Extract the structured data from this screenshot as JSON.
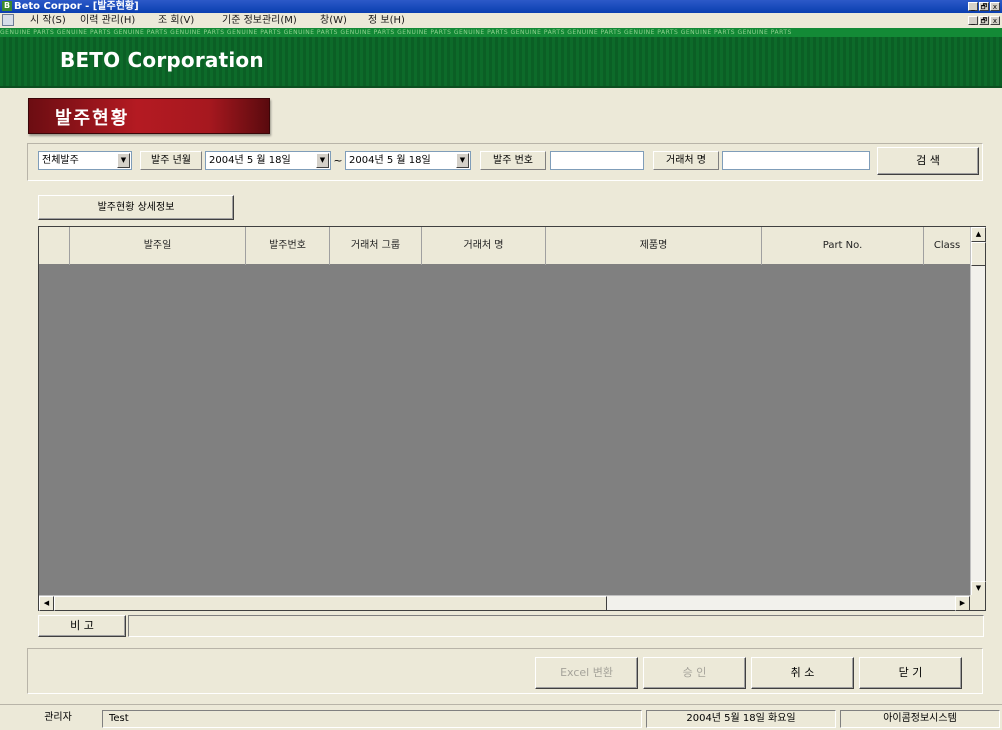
{
  "window": {
    "title": "Beto Corpor - [발주현황]",
    "controls": [
      "_",
      "🗗",
      "x"
    ]
  },
  "menu": {
    "items": [
      "시 작(S)",
      "이력 관리(H)",
      "조 회(V)",
      "기준 정보관리(M)",
      "창(W)",
      "정 보(H)"
    ]
  },
  "banner": {
    "company": "BETO Corporation",
    "pattern_text": "GENUINE PARTS GENUINE PARTS GENUINE PARTS GENUINE PARTS GENUINE PARTS GENUINE PARTS GENUINE PARTS GENUINE PARTS GENUINE PARTS GENUINE PARTS GENUINE PARTS GENUINE PARTS GENUINE PARTS GENUINE PARTS"
  },
  "screen_title": "발주현황",
  "search": {
    "order_type": "전체발주",
    "order_date_label": "발주 년월",
    "date_from": "2004년 5 월 18일",
    "range_sep": "~",
    "date_to": "2004년 5 월 18일",
    "order_no_label": "발주 번호",
    "order_no_value": "",
    "vendor_name_label": "거래처 명",
    "vendor_name_value": "",
    "search_button": "검  색"
  },
  "detail_tab": "발주현황 상세정보",
  "grid": {
    "columns": [
      "",
      "발주일",
      "발주번호",
      "거래처 그룹",
      "거래처 명",
      "제품명",
      "Part No.",
      "Class"
    ],
    "rows": []
  },
  "remark": {
    "label": "비 고",
    "value": ""
  },
  "buttons": {
    "excel": "Excel 변환",
    "approve": "승 인",
    "cancel": "취 소",
    "close": "닫 기"
  },
  "status": {
    "user_role": "관리자",
    "user_name": "Test",
    "date": "2004년 5월 18일 화요일",
    "system": "아이콤정보시스템"
  },
  "colors": {
    "banner_green": "#0d6b2a",
    "title_red": "#b41a22",
    "grid_bg": "#808080"
  }
}
